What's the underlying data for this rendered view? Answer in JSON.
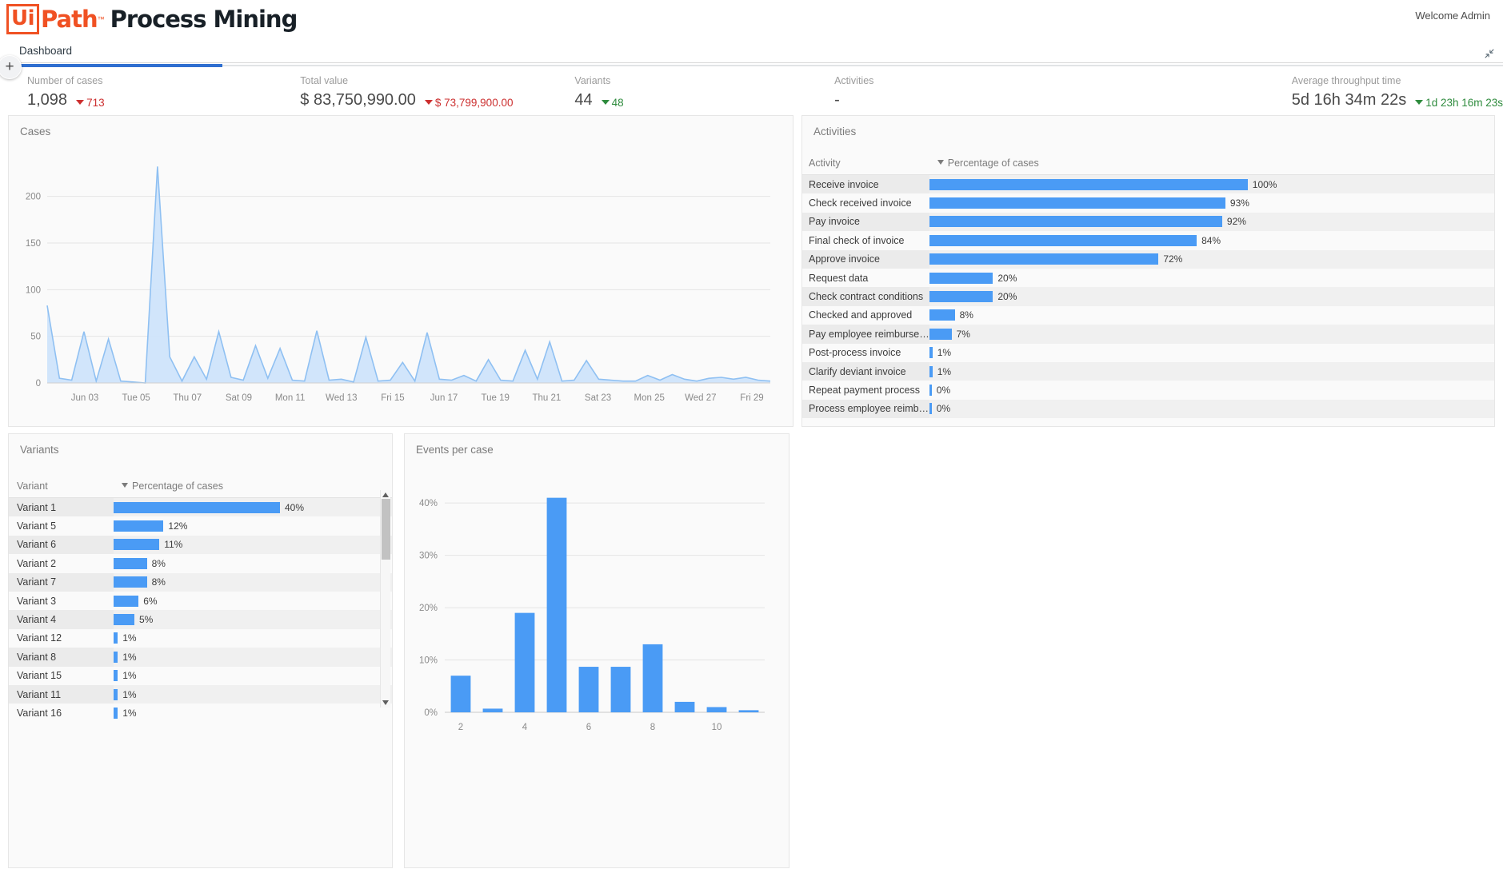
{
  "header": {
    "logo_ui": "Ui",
    "logo_path": "Path",
    "logo_tm": "™",
    "product": "Process Mining",
    "welcome": "Welcome Admin"
  },
  "tabs": [
    {
      "label": "Dashboard",
      "active": true
    }
  ],
  "icons": {
    "add": "+",
    "collapse": "collapse-icon"
  },
  "kpis": [
    {
      "label": "Number of cases",
      "value": "1,098",
      "delta": "713",
      "direction": "down",
      "delta_color": "#cc2f2f"
    },
    {
      "label": "Total value",
      "value": "$ 83,750,990.00",
      "delta": "$ 73,799,900.00",
      "direction": "down",
      "delta_color": "#cc2f2f"
    },
    {
      "label": "Variants",
      "value": "44",
      "delta": "48",
      "direction": "down",
      "delta_color": "#2e8b3d"
    },
    {
      "label": "Activities",
      "value": "-",
      "delta": "",
      "direction": "none",
      "delta_color": ""
    },
    {
      "label": "Average throughput time",
      "value": "5d 16h 34m 22s",
      "delta": "1d 23h 16m 23s",
      "direction": "down",
      "delta_color": "#2e8b3d"
    }
  ],
  "cases_panel": {
    "title": "Cases"
  },
  "activities_panel": {
    "title": "Activities",
    "columns": {
      "activity": "Activity",
      "percentage": "Percentage of cases"
    },
    "rows": [
      {
        "name": "Receive invoice",
        "label": "100%",
        "value": 100
      },
      {
        "name": "Check received invoice",
        "label": "93%",
        "value": 93
      },
      {
        "name": "Pay invoice",
        "label": "92%",
        "value": 92
      },
      {
        "name": "Final check of invoice",
        "label": "84%",
        "value": 84
      },
      {
        "name": "Approve invoice",
        "label": "72%",
        "value": 72
      },
      {
        "name": "Request data",
        "label": "20%",
        "value": 20
      },
      {
        "name": "Check contract conditions",
        "label": "20%",
        "value": 20
      },
      {
        "name": "Checked and approved",
        "label": "8%",
        "value": 8
      },
      {
        "name": "Pay employee reimburse…",
        "label": "7%",
        "value": 7
      },
      {
        "name": "Post-process invoice",
        "label": "1%",
        "value": 1
      },
      {
        "name": "Clarify deviant invoice",
        "label": "1%",
        "value": 1
      },
      {
        "name": "Repeat payment process",
        "label": "0%",
        "value": 0.4
      },
      {
        "name": "Process employee reimb…",
        "label": "0%",
        "value": 0.4
      }
    ]
  },
  "variants_panel": {
    "title": "Variants",
    "columns": {
      "variant": "Variant",
      "percentage": "Percentage of cases"
    },
    "rows": [
      {
        "name": "Variant 1",
        "label": "40%",
        "value": 40
      },
      {
        "name": "Variant 5",
        "label": "12%",
        "value": 12
      },
      {
        "name": "Variant 6",
        "label": "11%",
        "value": 11
      },
      {
        "name": "Variant 2",
        "label": "8%",
        "value": 8
      },
      {
        "name": "Variant 7",
        "label": "8%",
        "value": 8
      },
      {
        "name": "Variant 3",
        "label": "6%",
        "value": 6
      },
      {
        "name": "Variant 4",
        "label": "5%",
        "value": 5
      },
      {
        "name": "Variant 12",
        "label": "1%",
        "value": 1
      },
      {
        "name": "Variant 8",
        "label": "1%",
        "value": 1
      },
      {
        "name": "Variant 15",
        "label": "1%",
        "value": 1
      },
      {
        "name": "Variant 11",
        "label": "1%",
        "value": 1
      },
      {
        "name": "Variant 16",
        "label": "1%",
        "value": 1
      }
    ]
  },
  "events_panel": {
    "title": "Events per case"
  },
  "colors": {
    "bar_blue": "#4a9bf5",
    "area_blue": "#cfe4fb",
    "line_blue": "#8fc0f2",
    "accent_orange": "#f05123",
    "progress_blue": "#2f6fd0",
    "positive_green": "#2e8b3d",
    "negative_red": "#cc2f2f"
  },
  "chart_data": [
    {
      "type": "area",
      "title": "Cases",
      "xlabel": "",
      "ylabel": "",
      "ylim": [
        0,
        240
      ],
      "yticks": [
        0,
        50,
        100,
        150,
        200
      ],
      "ytick_labels": [
        "0",
        "50",
        "100",
        "150",
        "200"
      ],
      "xtick_labels": [
        "Jun 03",
        "Tue 05",
        "Thu 07",
        "Sat 09",
        "Mon 11",
        "Wed 13",
        "Fri 15",
        "Jun 17",
        "Tue 19",
        "Thu 21",
        "Sat 23",
        "Mon 25",
        "Wed 27",
        "Fri 29"
      ],
      "grid": true,
      "x": [
        1,
        2,
        3,
        4,
        5,
        6,
        7,
        8,
        9,
        10,
        11,
        12,
        13,
        14,
        15,
        16,
        17,
        18,
        19,
        20,
        21,
        22,
        23,
        24,
        25,
        26,
        27,
        28,
        29,
        30,
        31,
        32,
        33,
        34,
        35,
        36,
        37,
        38,
        39,
        40,
        41,
        42,
        43,
        44,
        45,
        46,
        47,
        48,
        49,
        50,
        51,
        52,
        53,
        54,
        55,
        56,
        57,
        58,
        59,
        60
      ],
      "values": [
        83,
        5,
        3,
        55,
        2,
        47,
        2,
        1,
        0,
        232,
        28,
        2,
        28,
        4,
        55,
        6,
        3,
        40,
        5,
        37,
        3,
        2,
        56,
        3,
        4,
        1,
        49,
        2,
        3,
        22,
        2,
        54,
        4,
        3,
        8,
        2,
        25,
        3,
        2,
        35,
        4,
        44,
        2,
        3,
        24,
        4,
        3,
        2,
        2,
        8,
        3,
        9,
        4,
        2,
        5,
        6,
        4,
        6,
        3,
        2
      ]
    },
    {
      "type": "bar",
      "title": "Events per case",
      "xlabel": "",
      "ylabel": "",
      "ylim": [
        0,
        44
      ],
      "yticks": [
        0,
        10,
        20,
        30,
        40
      ],
      "ytick_labels": [
        "0%",
        "10%",
        "20%",
        "30%",
        "40%"
      ],
      "categories": [
        "2",
        "3",
        "4",
        "5",
        "6",
        "7",
        "8",
        "9",
        "10",
        "11"
      ],
      "xtick_labels": [
        "2",
        "4",
        "6",
        "8",
        "10"
      ],
      "values": [
        7,
        0.7,
        19,
        41,
        8.7,
        8.7,
        13,
        2,
        1,
        0.4
      ],
      "grid": true
    }
  ]
}
